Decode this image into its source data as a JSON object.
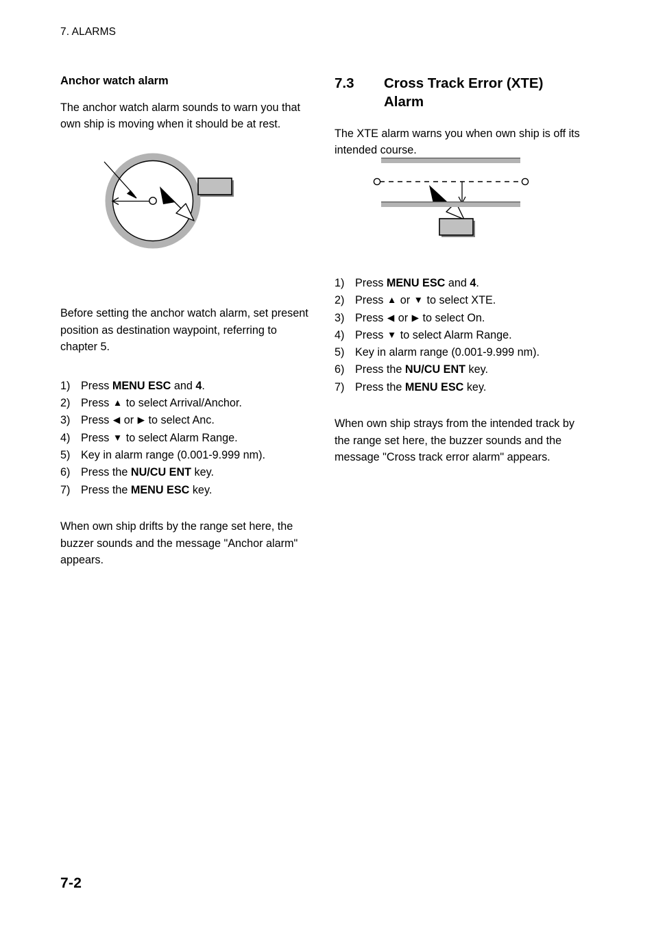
{
  "page": {
    "running_header": "7. ALARMS",
    "page_number": "7-2"
  },
  "left_column": {
    "heading": "Anchor watch alarm",
    "intro": "The anchor watch alarm sounds to warn you that own ship is moving when it should be at rest.",
    "figure": {
      "name": "anchor-watch-alarm-diagram",
      "ring_color": "#b3b3b3",
      "label_box_fill": "#c0c0c0",
      "label_box_text": "",
      "elements": [
        "alarm-range-ring",
        "destination-waypoint",
        "alarm-range-arrow",
        "own-ship-marker",
        "drift-arrow",
        "callout-box"
      ]
    },
    "note": "Before setting the anchor watch alarm, set present position as destination waypoint, referring to chapter 5.",
    "steps": [
      {
        "num": "1)",
        "pre": "Press ",
        "bold1": "MENU ESC",
        "mid": " and ",
        "bold2": "4",
        "post": "."
      },
      {
        "num": "2)",
        "pre": "Press ",
        "key1": "▲",
        "mid": " to select Arrival/Anchor.",
        "post": ""
      },
      {
        "num": "3)",
        "pre": "Press ",
        "key1": "◀",
        "mid": " or ",
        "key2": "▶",
        "post": " to select Anc."
      },
      {
        "num": "4)",
        "pre": "Press ",
        "key1": "▼",
        "mid": " to select Alarm Range.",
        "post": ""
      },
      {
        "num": "5)",
        "pre": "Key in alarm range (0.001-9.999 nm).",
        "post": ""
      },
      {
        "num": "6)",
        "pre": "Press the ",
        "bold1": "NU/CU ENT",
        "post": " key."
      },
      {
        "num": "7)",
        "pre": "Press the ",
        "bold1": "MENU ESC",
        "post": " key."
      }
    ],
    "outro": "When own ship drifts by the range set here, the buzzer sounds and the message \"Anchor alarm\" appears."
  },
  "right_column": {
    "section_number": "7.3",
    "section_title": "Cross Track Error (XTE) Alarm",
    "intro": "The XTE alarm warns you when own ship is off its intended course.",
    "figure": {
      "name": "cross-track-error-diagram",
      "band_color": "#b3b3b3",
      "label_box_fill": "#c0c0c0",
      "label_box_text": "",
      "elements": [
        "track-limit-upper",
        "intended-track-dashed-line",
        "start-waypoint",
        "destination-waypoint",
        "xte-range-arrow",
        "own-ship-marker",
        "deviation-arrow",
        "track-limit-lower",
        "callout-box"
      ]
    },
    "steps": [
      {
        "num": "1)",
        "pre": "Press ",
        "bold1": "MENU ESC",
        "mid": " and ",
        "bold2": "4",
        "post": "."
      },
      {
        "num": "2)",
        "pre": "Press ",
        "key1": "▲",
        "mid": " or ",
        "key2": "▼",
        "post": " to select XTE."
      },
      {
        "num": "3)",
        "pre": "Press ",
        "key1": "◀",
        "mid": " or ",
        "key2": "▶",
        "post": " to select On."
      },
      {
        "num": "4)",
        "pre": "Press ",
        "key1": "▼",
        "mid": " to select Alarm Range.",
        "post": ""
      },
      {
        "num": "5)",
        "pre": "Key in alarm range (0.001-9.999 nm).",
        "post": ""
      },
      {
        "num": "6)",
        "pre": "Press the ",
        "bold1": "NU/CU ENT",
        "post": " key."
      },
      {
        "num": "7)",
        "pre": "Press the ",
        "bold1": "MENU ESC",
        "post": " key."
      }
    ],
    "outro": "When own ship strays from the intended track by the range set here, the buzzer sounds and the message \"Cross track error alarm\" appears."
  }
}
